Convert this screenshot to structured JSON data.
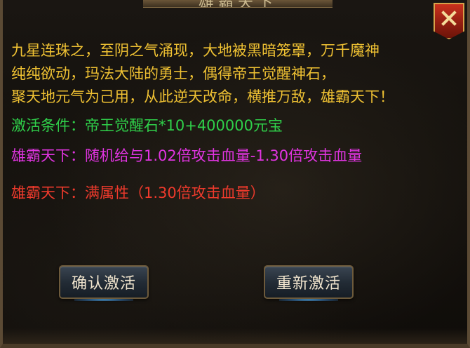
{
  "window": {
    "title": "雄霸天下"
  },
  "description": {
    "lines": [
      "九星连珠之，至阴之气涌现，大地被黑暗笼罩，万千魔神",
      "纯纯欲动，玛法大陆的勇士，偶得帝王觉醒神石，",
      "聚天地元气为己用，从此逆天改命，横推万敌，雄霸天下！"
    ]
  },
  "activation": {
    "condition": "激活条件：帝王觉醒石*10+400000元宝",
    "effect_random": "雄霸天下：随机给与1.02倍攻击血量-1.30倍攻击血量",
    "effect_full": "雄霸天下：满属性（1.30倍攻击血量）"
  },
  "buttons": {
    "confirm_label": "确认激活",
    "reset_label": "重新激活"
  },
  "icons": {
    "close": "close-icon"
  },
  "colors": {
    "intro_text": "#f0c233",
    "condition_text": "#2fd04a",
    "effect_random_text": "#e034e0",
    "effect_full_text": "#ee3a2c",
    "close_button": "#c9311d"
  }
}
